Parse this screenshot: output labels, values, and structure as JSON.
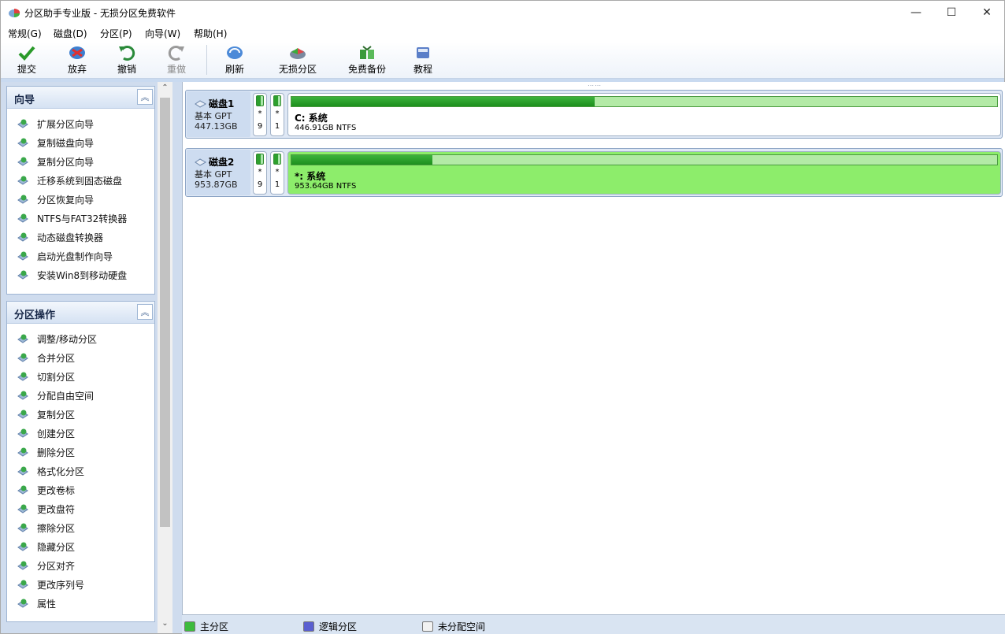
{
  "window": {
    "title": "分区助手专业版 - 无损分区免费软件",
    "min_glyph": "—",
    "max_glyph": "☐",
    "close_glyph": "✕"
  },
  "menu": [
    "常规(G)",
    "磁盘(D)",
    "分区(P)",
    "向导(W)",
    "帮助(H)"
  ],
  "toolbar": {
    "commit": "提交",
    "discard": "放弃",
    "undo": "撤销",
    "redo": "重做",
    "refresh": "刷新",
    "lossless": "无损分区",
    "backup": "免费备份",
    "tutorial": "教程"
  },
  "wizard_group": {
    "title": "向导",
    "items": [
      {
        "label": "扩展分区向导",
        "icon": "extend-partition-icon"
      },
      {
        "label": "复制磁盘向导",
        "icon": "copy-disk-icon"
      },
      {
        "label": "复制分区向导",
        "icon": "copy-partition-icon"
      },
      {
        "label": "迁移系统到固态磁盘",
        "icon": "migrate-ssd-icon"
      },
      {
        "label": "分区恢复向导",
        "icon": "partition-recovery-icon"
      },
      {
        "label": "NTFS与FAT32转换器",
        "icon": "ntfs-fat32-converter-icon"
      },
      {
        "label": "动态磁盘转换器",
        "icon": "dynamic-disk-converter-icon"
      },
      {
        "label": "启动光盘制作向导",
        "icon": "bootable-disc-icon"
      },
      {
        "label": "安装Win8到移动硬盘",
        "icon": "win8-to-go-icon"
      }
    ]
  },
  "partition_group": {
    "title": "分区操作",
    "items": [
      {
        "label": "调整/移动分区",
        "icon": "resize-move-icon"
      },
      {
        "label": "合并分区",
        "icon": "merge-partition-icon"
      },
      {
        "label": "切割分区",
        "icon": "split-partition-icon"
      },
      {
        "label": "分配自由空间",
        "icon": "allocate-space-icon"
      },
      {
        "label": "复制分区",
        "icon": "copy-partition-icon"
      },
      {
        "label": "创建分区",
        "icon": "create-partition-icon"
      },
      {
        "label": "删除分区",
        "icon": "delete-partition-icon"
      },
      {
        "label": "格式化分区",
        "icon": "format-partition-icon"
      },
      {
        "label": "更改卷标",
        "icon": "change-label-icon"
      },
      {
        "label": "更改盘符",
        "icon": "change-drive-letter-icon"
      },
      {
        "label": "擦除分区",
        "icon": "wipe-partition-icon"
      },
      {
        "label": "隐藏分区",
        "icon": "hide-partition-icon"
      },
      {
        "label": "分区对齐",
        "icon": "align-partition-icon"
      },
      {
        "label": "更改序列号",
        "icon": "change-serial-icon"
      },
      {
        "label": "属性",
        "icon": "properties-icon"
      }
    ]
  },
  "disks": [
    {
      "name": "磁盘1",
      "type": "基本 GPT",
      "size": "447.13GB",
      "small_partitions": [
        {
          "star": "*",
          "num": "9"
        },
        {
          "star": "*",
          "num": "1"
        }
      ],
      "main_partition": {
        "label": "C: 系统",
        "detail": "446.91GB NTFS",
        "used_fraction": 0.43,
        "selected": false
      }
    },
    {
      "name": "磁盘2",
      "type": "基本 GPT",
      "size": "953.87GB",
      "small_partitions": [
        {
          "star": "*",
          "num": "9"
        },
        {
          "star": "*",
          "num": "1"
        }
      ],
      "main_partition": {
        "label": "*: 系统",
        "detail": "953.64GB NTFS",
        "used_fraction": 0.2,
        "selected": true
      }
    }
  ],
  "legend": [
    {
      "label": "主分区",
      "color": "#3dbb3d"
    },
    {
      "label": "逻辑分区",
      "color": "#5a5fd0"
    },
    {
      "label": "未分配空间",
      "color": "#f2f2f2"
    }
  ],
  "colors": {
    "selected_partition": "#8ded6b",
    "panel_bg": "#cfdcee"
  }
}
